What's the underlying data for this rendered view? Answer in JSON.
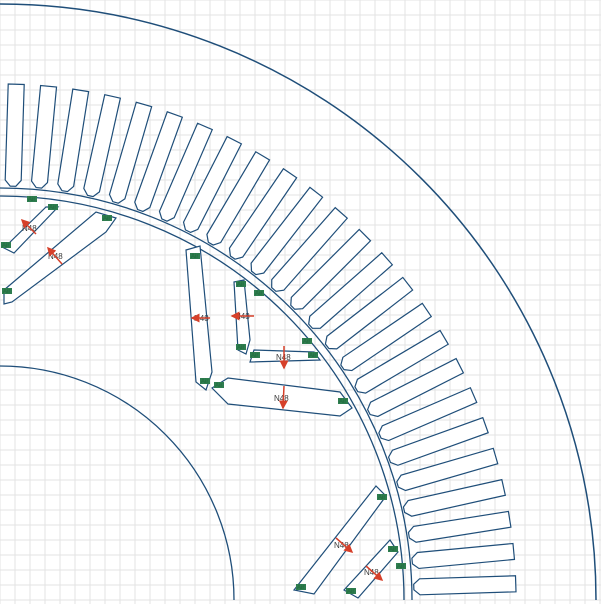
{
  "canvas": {
    "background": "#ffffff",
    "grid_color": "#e3e3e3",
    "outline_color": "#1f4e79",
    "arrow_color": "#d6402a",
    "air_marker_color": "#2e7d4f"
  },
  "labels": {
    "magnet": "N48",
    "air": "Air"
  },
  "geometry_names": [
    "stator-outer-arc",
    "stator-bore-arc",
    "rotor-outer-arc",
    "shaft-arc"
  ],
  "magnets": [
    {
      "id": "m1",
      "label": "N48"
    },
    {
      "id": "m2",
      "label": "N48"
    },
    {
      "id": "m3",
      "label": "N48"
    },
    {
      "id": "m4",
      "label": "N48"
    },
    {
      "id": "m5",
      "label": "N48"
    },
    {
      "id": "m6",
      "label": "N48"
    },
    {
      "id": "m7",
      "label": "N48"
    },
    {
      "id": "m8",
      "label": "N48"
    }
  ]
}
